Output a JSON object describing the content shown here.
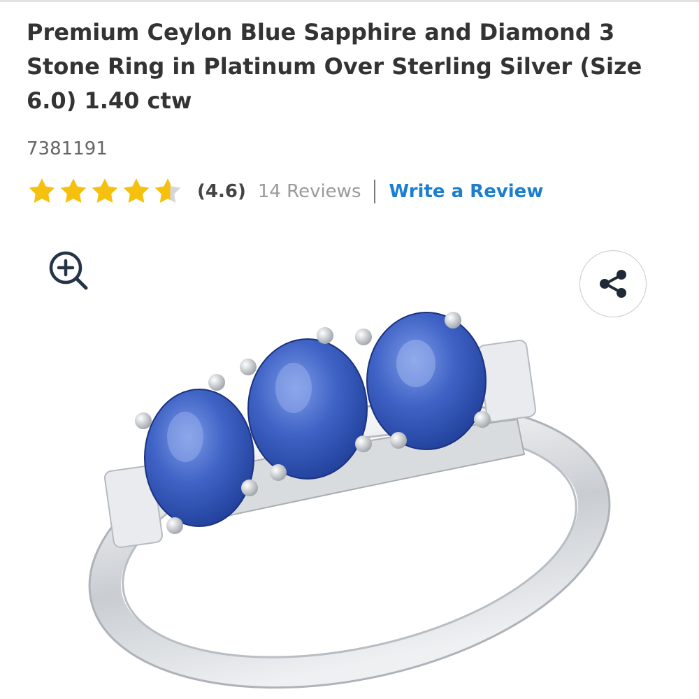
{
  "product": {
    "title": "Premium Ceylon Blue Sapphire and Diamond 3 Stone Ring in Platinum Over Sterling Silver (Size 6.0) 1.40 ctw",
    "sku": "7381191"
  },
  "rating": {
    "score": 4.6,
    "max": 5,
    "score_label": "(4.6)",
    "reviews_label": "14 Reviews",
    "write_review_label": "Write a Review",
    "star_color": "#f6c10e",
    "star_empty_color": "#d6d6d6"
  },
  "image_controls": {
    "zoom_icon": "zoom-in-icon",
    "share_icon": "share-icon"
  },
  "product_image": {
    "subject": "ring-three-blue-sapphires-diamonds",
    "stone_color": "#3f63c6",
    "metal_color": "#d4d7db"
  },
  "colors": {
    "link": "#1b7fd0",
    "text": "#333333",
    "muted": "#9a9a9a",
    "icon_dark": "#243447"
  }
}
